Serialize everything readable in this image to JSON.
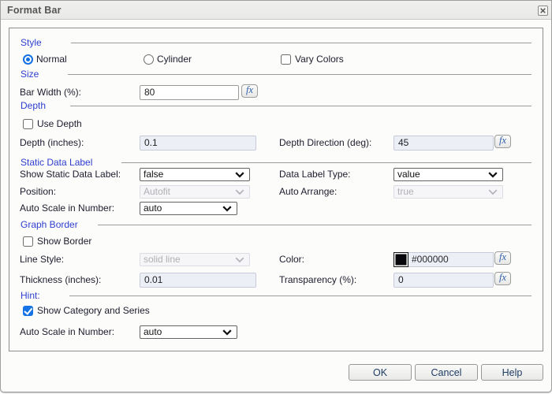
{
  "dialog": {
    "title": "Format Bar"
  },
  "sections": {
    "style": {
      "heading": "Style",
      "normal_label": "Normal",
      "normal_selected": true,
      "cylinder_label": "Cylinder",
      "cylinder_selected": false,
      "vary_colors_label": "Vary Colors",
      "vary_colors_checked": false
    },
    "size": {
      "heading": "Size",
      "bar_width_label": "Bar Width (%):",
      "bar_width_value": "80"
    },
    "depth": {
      "heading": "Depth",
      "use_depth_label": "Use Depth",
      "use_depth_checked": false,
      "depth_inches_label": "Depth (inches):",
      "depth_inches_value": "0.1",
      "depth_inches_disabled": true,
      "depth_direction_label": "Depth Direction (deg):",
      "depth_direction_value": "45",
      "depth_direction_disabled": true
    },
    "static_data_label": {
      "heading": "Static Data Label",
      "show_label": "Show Static Data Label:",
      "show_value": "false",
      "type_label": "Data Label Type:",
      "type_value": "value",
      "position_label": "Position:",
      "position_value": "Autofit",
      "position_disabled": true,
      "auto_arrange_label": "Auto Arrange:",
      "auto_arrange_value": "true",
      "auto_arrange_disabled": true,
      "auto_scale_label": "Auto Scale in Number:",
      "auto_scale_value": "auto"
    },
    "graph_border": {
      "heading": "Graph Border",
      "show_border_label": "Show Border",
      "show_border_checked": false,
      "line_style_label": "Line Style:",
      "line_style_value": "solid line",
      "line_style_disabled": true,
      "color_label": "Color:",
      "color_value": "#000000",
      "color_swatch": "#000000",
      "thickness_label": "Thickness (inches):",
      "thickness_value": "0.01",
      "thickness_disabled": true,
      "transparency_label": "Transparency (%):",
      "transparency_value": "0",
      "transparency_disabled": true
    },
    "hint": {
      "heading": "Hint:",
      "show_category_label": "Show Category and Series",
      "show_category_checked": true,
      "auto_scale_label": "Auto Scale in Number:",
      "auto_scale_value": "auto"
    }
  },
  "controls": {
    "fx_label": "fx"
  },
  "buttons": {
    "ok": "OK",
    "cancel": "Cancel",
    "help": "Help"
  },
  "colors": {
    "accent_blue": "#1573e6",
    "heading_blue": "#2e3ecf"
  }
}
